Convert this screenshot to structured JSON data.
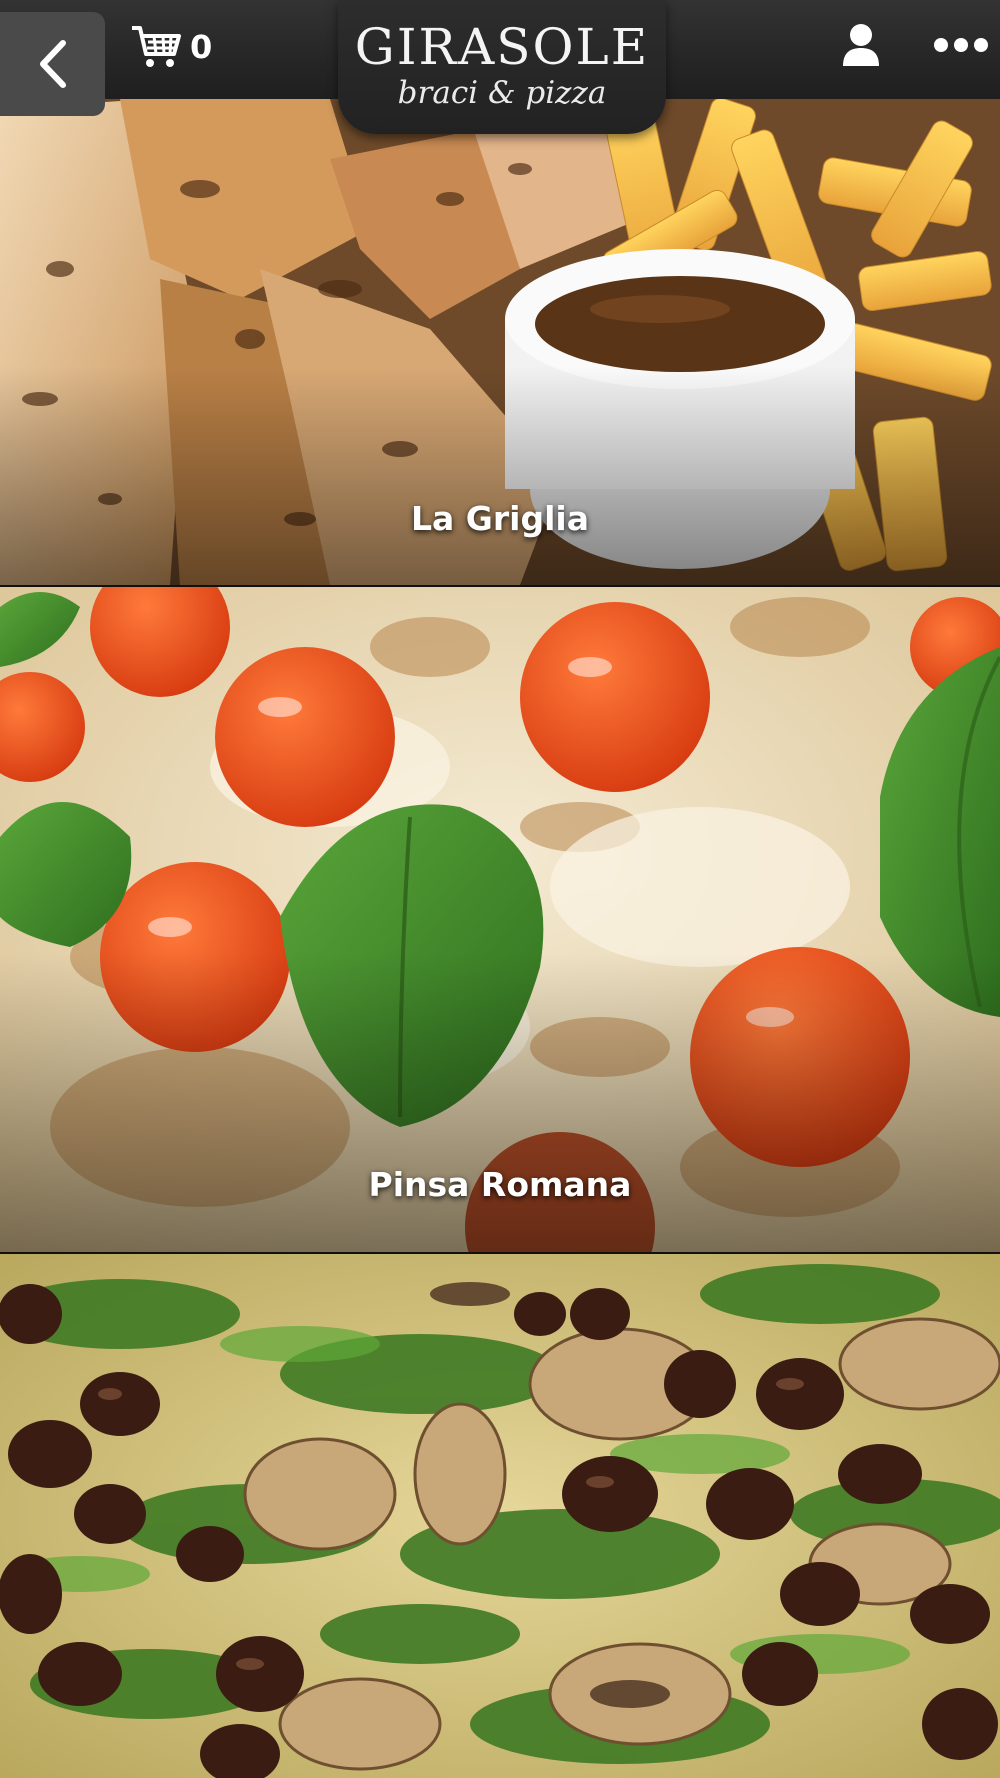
{
  "header": {
    "back_icon": "chevron-left-icon",
    "cart_icon": "shopping-cart-icon",
    "cart_count": "0",
    "logo": {
      "name": "GIRASOLE",
      "tagline": "braci & pizza"
    },
    "user_icon": "user-icon",
    "menu_icon": "more-horizontal-icon"
  },
  "categories": [
    {
      "label": "La Griglia"
    },
    {
      "label": "Pinsa Romana"
    },
    {
      "label": ""
    }
  ],
  "colors": {
    "header_bg": "#262626",
    "text": "#ffffff"
  }
}
